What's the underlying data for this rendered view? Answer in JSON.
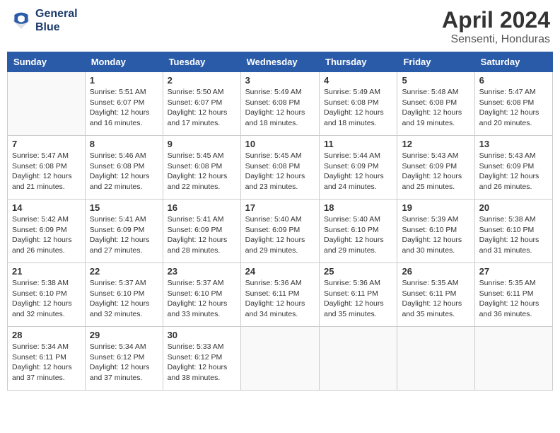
{
  "logo": {
    "line1": "General",
    "line2": "Blue"
  },
  "title": "April 2024",
  "location": "Sensenti, Honduras",
  "days_of_week": [
    "Sunday",
    "Monday",
    "Tuesday",
    "Wednesday",
    "Thursday",
    "Friday",
    "Saturday"
  ],
  "weeks": [
    [
      {
        "day": "",
        "info": ""
      },
      {
        "day": "1",
        "info": "Sunrise: 5:51 AM\nSunset: 6:07 PM\nDaylight: 12 hours\nand 16 minutes."
      },
      {
        "day": "2",
        "info": "Sunrise: 5:50 AM\nSunset: 6:07 PM\nDaylight: 12 hours\nand 17 minutes."
      },
      {
        "day": "3",
        "info": "Sunrise: 5:49 AM\nSunset: 6:08 PM\nDaylight: 12 hours\nand 18 minutes."
      },
      {
        "day": "4",
        "info": "Sunrise: 5:49 AM\nSunset: 6:08 PM\nDaylight: 12 hours\nand 18 minutes."
      },
      {
        "day": "5",
        "info": "Sunrise: 5:48 AM\nSunset: 6:08 PM\nDaylight: 12 hours\nand 19 minutes."
      },
      {
        "day": "6",
        "info": "Sunrise: 5:47 AM\nSunset: 6:08 PM\nDaylight: 12 hours\nand 20 minutes."
      }
    ],
    [
      {
        "day": "7",
        "info": "Sunrise: 5:47 AM\nSunset: 6:08 PM\nDaylight: 12 hours\nand 21 minutes."
      },
      {
        "day": "8",
        "info": "Sunrise: 5:46 AM\nSunset: 6:08 PM\nDaylight: 12 hours\nand 22 minutes."
      },
      {
        "day": "9",
        "info": "Sunrise: 5:45 AM\nSunset: 6:08 PM\nDaylight: 12 hours\nand 22 minutes."
      },
      {
        "day": "10",
        "info": "Sunrise: 5:45 AM\nSunset: 6:08 PM\nDaylight: 12 hours\nand 23 minutes."
      },
      {
        "day": "11",
        "info": "Sunrise: 5:44 AM\nSunset: 6:09 PM\nDaylight: 12 hours\nand 24 minutes."
      },
      {
        "day": "12",
        "info": "Sunrise: 5:43 AM\nSunset: 6:09 PM\nDaylight: 12 hours\nand 25 minutes."
      },
      {
        "day": "13",
        "info": "Sunrise: 5:43 AM\nSunset: 6:09 PM\nDaylight: 12 hours\nand 26 minutes."
      }
    ],
    [
      {
        "day": "14",
        "info": "Sunrise: 5:42 AM\nSunset: 6:09 PM\nDaylight: 12 hours\nand 26 minutes."
      },
      {
        "day": "15",
        "info": "Sunrise: 5:41 AM\nSunset: 6:09 PM\nDaylight: 12 hours\nand 27 minutes."
      },
      {
        "day": "16",
        "info": "Sunrise: 5:41 AM\nSunset: 6:09 PM\nDaylight: 12 hours\nand 28 minutes."
      },
      {
        "day": "17",
        "info": "Sunrise: 5:40 AM\nSunset: 6:09 PM\nDaylight: 12 hours\nand 29 minutes."
      },
      {
        "day": "18",
        "info": "Sunrise: 5:40 AM\nSunset: 6:10 PM\nDaylight: 12 hours\nand 29 minutes."
      },
      {
        "day": "19",
        "info": "Sunrise: 5:39 AM\nSunset: 6:10 PM\nDaylight: 12 hours\nand 30 minutes."
      },
      {
        "day": "20",
        "info": "Sunrise: 5:38 AM\nSunset: 6:10 PM\nDaylight: 12 hours\nand 31 minutes."
      }
    ],
    [
      {
        "day": "21",
        "info": "Sunrise: 5:38 AM\nSunset: 6:10 PM\nDaylight: 12 hours\nand 32 minutes."
      },
      {
        "day": "22",
        "info": "Sunrise: 5:37 AM\nSunset: 6:10 PM\nDaylight: 12 hours\nand 32 minutes."
      },
      {
        "day": "23",
        "info": "Sunrise: 5:37 AM\nSunset: 6:10 PM\nDaylight: 12 hours\nand 33 minutes."
      },
      {
        "day": "24",
        "info": "Sunrise: 5:36 AM\nSunset: 6:11 PM\nDaylight: 12 hours\nand 34 minutes."
      },
      {
        "day": "25",
        "info": "Sunrise: 5:36 AM\nSunset: 6:11 PM\nDaylight: 12 hours\nand 35 minutes."
      },
      {
        "day": "26",
        "info": "Sunrise: 5:35 AM\nSunset: 6:11 PM\nDaylight: 12 hours\nand 35 minutes."
      },
      {
        "day": "27",
        "info": "Sunrise: 5:35 AM\nSunset: 6:11 PM\nDaylight: 12 hours\nand 36 minutes."
      }
    ],
    [
      {
        "day": "28",
        "info": "Sunrise: 5:34 AM\nSunset: 6:11 PM\nDaylight: 12 hours\nand 37 minutes."
      },
      {
        "day": "29",
        "info": "Sunrise: 5:34 AM\nSunset: 6:12 PM\nDaylight: 12 hours\nand 37 minutes."
      },
      {
        "day": "30",
        "info": "Sunrise: 5:33 AM\nSunset: 6:12 PM\nDaylight: 12 hours\nand 38 minutes."
      },
      {
        "day": "",
        "info": ""
      },
      {
        "day": "",
        "info": ""
      },
      {
        "day": "",
        "info": ""
      },
      {
        "day": "",
        "info": ""
      }
    ]
  ]
}
